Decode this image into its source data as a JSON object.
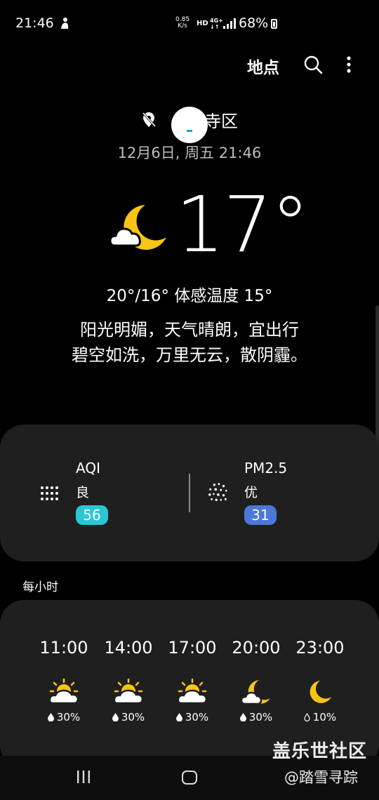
{
  "status_bar": {
    "time": "21:46",
    "speed_value": "0.85",
    "speed_unit": "K/s",
    "hd": "HD",
    "network": "4G+",
    "battery": "68%"
  },
  "header": {
    "places_label": "地点"
  },
  "location": {
    "name": "寺区",
    "datetime": "12月6日, 周五 21:46"
  },
  "current": {
    "icon": "cloudy-night-icon",
    "temperature": "17°",
    "range_feels": "20°/16° 体感温度 15°",
    "desc_line1": "阳光明媚，天气晴朗，宜出行",
    "desc_line2": "碧空如洗，万里无云，散阴霾。"
  },
  "air": {
    "aqi": {
      "title": "AQI",
      "level": "良",
      "value": "56",
      "color": "#2bc6d6"
    },
    "pm25": {
      "title": "PM2.5",
      "level": "优",
      "value": "31",
      "color": "#4b78d8"
    }
  },
  "hourly": {
    "label": "每小时",
    "items": [
      {
        "time": "11:00",
        "icon": "partly-cloudy-day-icon",
        "precip": "30%"
      },
      {
        "time": "14:00",
        "icon": "partly-cloudy-day-icon",
        "precip": "30%"
      },
      {
        "time": "17:00",
        "icon": "partly-cloudy-day-icon",
        "precip": "30%"
      },
      {
        "time": "20:00",
        "icon": "cloudy-night-icon",
        "precip": "30%"
      },
      {
        "time": "23:00",
        "icon": "moon-icon",
        "precip": "10%"
      }
    ]
  },
  "watermark": {
    "line1": "盖乐世社区",
    "line2": "@踏雪寻踪"
  },
  "colors": {
    "moon": "#f6c515",
    "sun": "#f6c515",
    "card_bg": "#1f1f1f"
  }
}
